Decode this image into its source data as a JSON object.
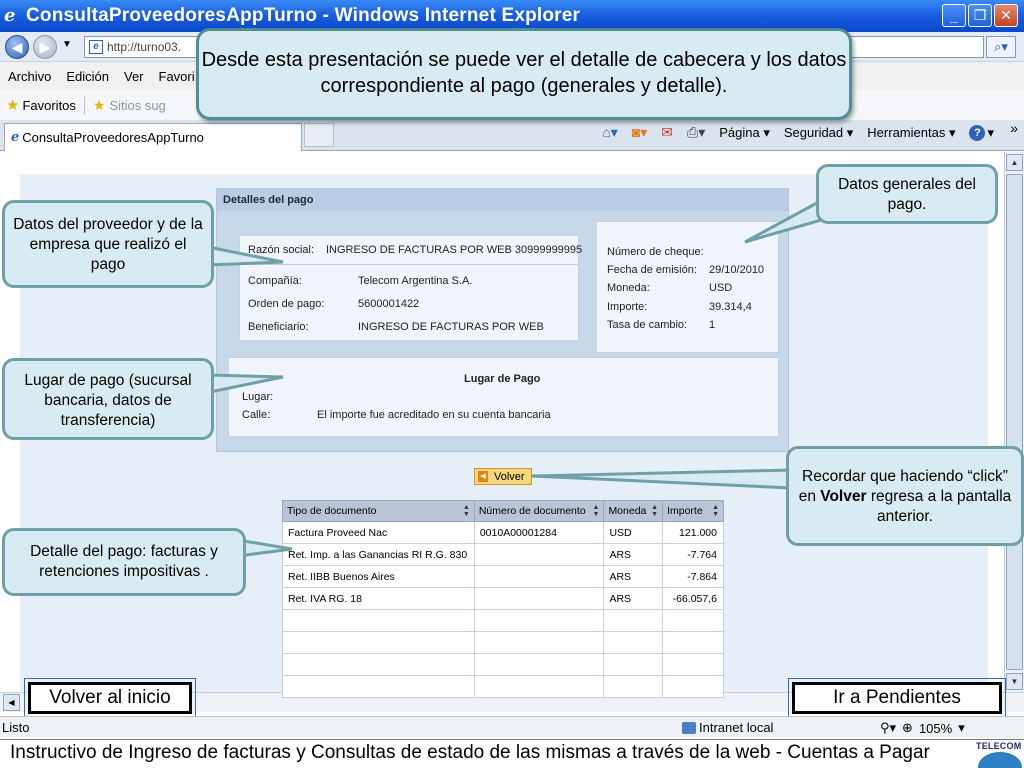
{
  "window": {
    "title": "ConsultaProveedoresAppTurno - Windows Internet Explorer",
    "url": "http://turno03.",
    "tab_title": "ConsultaProveedoresAppTurno"
  },
  "menu": [
    "Archivo",
    "Edición",
    "Ver",
    "Favori"
  ],
  "favbar": {
    "favoritos": "Favoritos",
    "sitios": "Sitios sug"
  },
  "command_bar": {
    "pagina": "Página",
    "seguridad": "Seguridad",
    "herramientas": "Herramientas"
  },
  "callouts": {
    "top": "Desde esta presentación se puede ver el detalle de cabecera y los datos correspondiente al pago (generales y detalle).",
    "proveedor": "Datos del proveedor y de la empresa que realizó el pago",
    "generales": "Datos generales del pago.",
    "lugar": "Lugar de pago (sucursal bancaria, datos de transferencia)",
    "volver_pre": "Recordar que haciendo “click” en ",
    "volver_bold": "Volver",
    "volver_post": " regresa a la pantalla anterior.",
    "detalle": "Detalle  del pago: facturas y retenciones impositivas ."
  },
  "panel": {
    "header": "Detalles del pago",
    "razon_label": "Razón social:",
    "razon_value": "INGRESO DE FACTURAS POR WEB   30999999995",
    "compania_label": "Compañía:",
    "compania_value": "Telecom Argentina S.A.",
    "orden_label": "Orden de pago:",
    "orden_value": "5600001422",
    "beneficiario_label": "Beneficiario:",
    "beneficiario_value": "INGRESO DE FACTURAS POR WEB",
    "cheque_label": "Número de cheque:",
    "cheque_value": "",
    "fecha_label": "Fecha de emisión:",
    "fecha_value": "29/10/2010",
    "moneda_label": "Moneda:",
    "moneda_value": "USD",
    "importe_label": "Importe:",
    "importe_value": "39.314,4",
    "tasa_label": "Tasa de cambio:",
    "tasa_value": "1",
    "lugar_title": "Lugar de Pago",
    "lugar_label": "Lugar:",
    "calle_label": "Calle:",
    "calle_value": "El importe fue acreditado en su cuenta bancaria"
  },
  "volver_button": "Volver",
  "table": {
    "headers": [
      "Tipo de documento",
      "Número de documento",
      "Moneda",
      "Importe"
    ],
    "rows": [
      [
        "Factura Proveed Nac",
        "0010A00001284",
        "USD",
        "121.000"
      ],
      [
        "Ret. Imp. a las Ganancias RI R.G. 830",
        "",
        "ARS",
        "-7.764"
      ],
      [
        "Ret. IIBB Buenos Aires",
        "",
        "ARS",
        "-7.864"
      ],
      [
        "Ret. IVA RG. 18",
        "",
        "ARS",
        "-66.057,6"
      ],
      [
        "",
        "",
        "",
        ""
      ],
      [
        "",
        "",
        "",
        ""
      ],
      [
        "",
        "",
        "",
        ""
      ],
      [
        "",
        "",
        "",
        ""
      ]
    ]
  },
  "nav": {
    "volver_inicio": "Volver al inicio",
    "ir_pendientes": "Ir a Pendientes"
  },
  "status": {
    "left": "Listo",
    "zone": "Intranet local",
    "zoom": "105%"
  },
  "footer": {
    "text": "Instructivo de Ingreso de facturas y Consultas de estado de las mismas a través de la web    -    Cuentas a Pagar",
    "logo": "TELECOM"
  }
}
